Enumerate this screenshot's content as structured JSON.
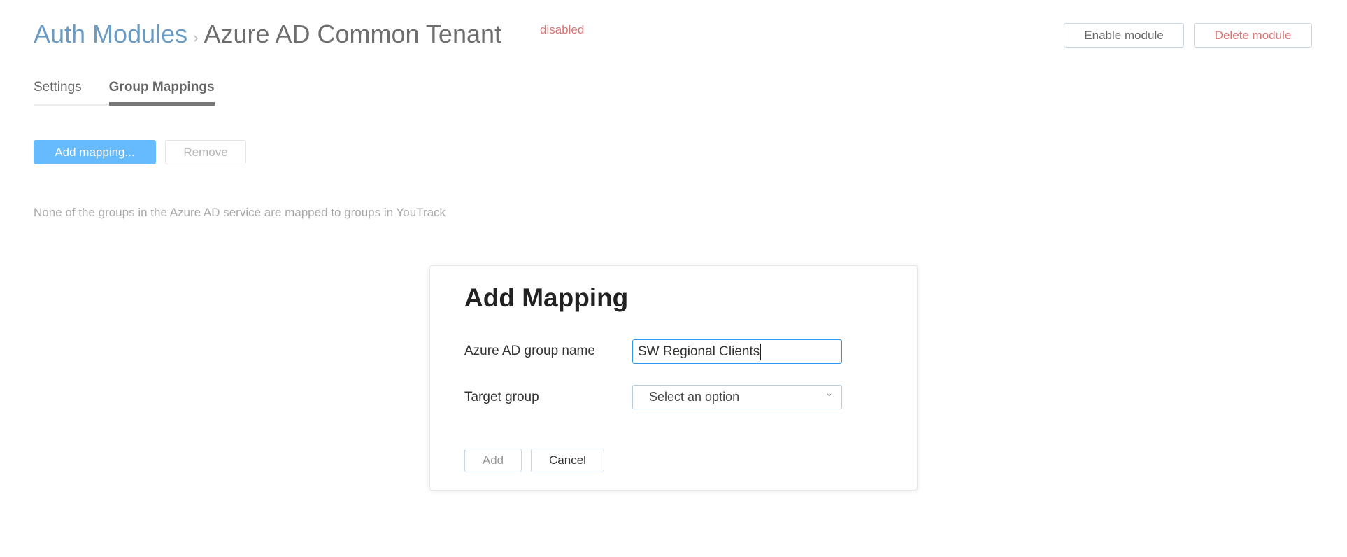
{
  "header": {
    "breadcrumb_parent": "Auth Modules",
    "breadcrumb_separator": "›",
    "title": "Azure AD Common Tenant",
    "status": "disabled"
  },
  "actions": {
    "enable": "Enable module",
    "delete": "Delete module"
  },
  "tabs": [
    {
      "label": "Settings",
      "active": false
    },
    {
      "label": "Group Mappings",
      "active": true
    }
  ],
  "toolbar": {
    "add": "Add mapping...",
    "remove": "Remove"
  },
  "empty_message": "None of the groups in the Azure AD service are mapped to groups in YouTrack",
  "dialog": {
    "title": "Add Mapping",
    "group_name_label": "Azure AD group name",
    "group_name_value": "SW Regional Clients",
    "target_label": "Target group",
    "target_placeholder": "Select an option",
    "add": "Add",
    "cancel": "Cancel"
  },
  "colors": {
    "link": "#6a9bc4",
    "danger": "#d97575",
    "primary": "#66bbff",
    "focus": "#2d9af0"
  }
}
